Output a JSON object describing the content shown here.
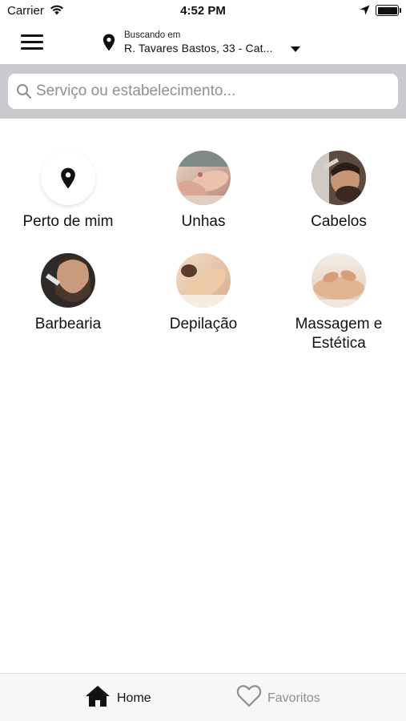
{
  "status_bar": {
    "carrier": "Carrier",
    "time": "4:52 PM",
    "icons": [
      "wifi-icon",
      "location-arrow-icon",
      "battery-icon"
    ]
  },
  "header": {
    "menu_icon": "hamburger-menu-icon",
    "location": {
      "icon": "map-pin-icon",
      "label": "Buscando em",
      "address": "R. Tavares Bastos, 33 - Cat...",
      "dropdown_icon": "caret-down-icon"
    }
  },
  "search": {
    "icon": "search-icon",
    "placeholder": "Serviço ou estabelecimento...",
    "value": ""
  },
  "categories": [
    {
      "label": "Perto de mim",
      "icon": "map-pin-icon"
    },
    {
      "label": "Unhas",
      "image": "manicure photo"
    },
    {
      "label": "Cabelos",
      "image": "haircut photo"
    },
    {
      "label": "Barbearia",
      "image": "beard trim photo"
    },
    {
      "label": "Depilação",
      "image": "waxing photo"
    },
    {
      "label": "Massagem e Estética",
      "image": "massage photo"
    }
  ],
  "tab_bar": {
    "tabs": [
      {
        "label": "Home",
        "icon": "home-icon",
        "active": true
      },
      {
        "label": "Favoritos",
        "icon": "heart-icon",
        "active": false
      }
    ]
  },
  "colors": {
    "search_band": "#c9c9ce",
    "tab_bar_bg": "#f7f7f7",
    "inactive_tab": "#8e8e93",
    "text": "#111111"
  }
}
